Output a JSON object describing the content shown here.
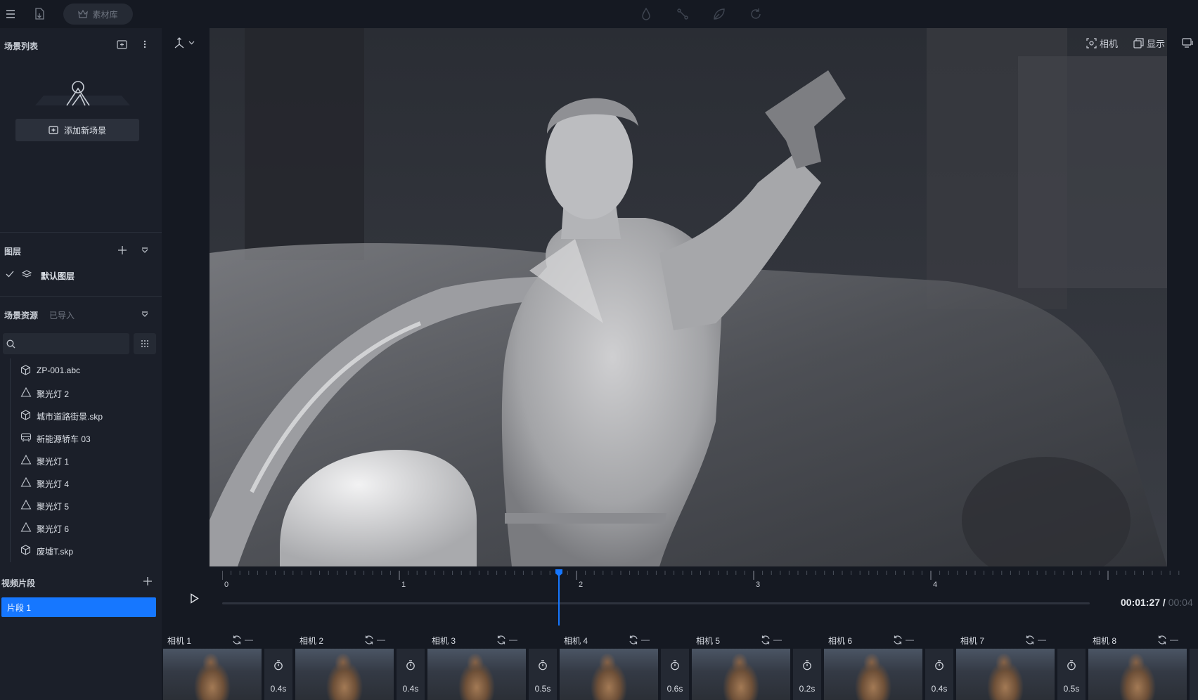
{
  "topbar": {
    "library_label": "素材库",
    "center_icons": [
      "drop-icon",
      "bone-icon",
      "leaf-icon",
      "refresh-icon"
    ]
  },
  "scene_list": {
    "title": "场景列表",
    "add_scene_label": "添加新场景"
  },
  "layers": {
    "title": "图层",
    "items": [
      {
        "label": "默认图层",
        "checked": true
      }
    ]
  },
  "assets": {
    "title": "场景资源",
    "tab_imported": "已导入",
    "search_placeholder": "",
    "items": [
      {
        "label": "ZP-001.abc",
        "icon": "cube-icon"
      },
      {
        "label": "聚光灯 2",
        "icon": "spotlight-icon"
      },
      {
        "label": "城市道路街景.skp",
        "icon": "cube-icon"
      },
      {
        "label": "新能源轿车 03",
        "icon": "car-icon"
      },
      {
        "label": "聚光灯 1",
        "icon": "spotlight-icon"
      },
      {
        "label": "聚光灯 4",
        "icon": "spotlight-icon"
      },
      {
        "label": "聚光灯 5",
        "icon": "spotlight-icon"
      },
      {
        "label": "聚光灯 6",
        "icon": "spotlight-icon"
      },
      {
        "label": "废墟T.skp",
        "icon": "cube-icon"
      }
    ]
  },
  "viewport": {
    "camera_label": "相机",
    "display_label": "显示"
  },
  "clips": {
    "title": "视频片段",
    "active_segment": "片段 1"
  },
  "timeline": {
    "ticks": [
      "0",
      "1",
      "2",
      "3",
      "4"
    ],
    "current_time": "00:01:27",
    "separator": " / ",
    "total_time": "00:04",
    "playhead_seconds": 1.9
  },
  "cameras": [
    {
      "name": "相机 1",
      "duration": "0.4s"
    },
    {
      "name": "相机 2",
      "duration": "0.4s"
    },
    {
      "name": "相机 3",
      "duration": "0.5s"
    },
    {
      "name": "相机 4",
      "duration": "0.6s"
    },
    {
      "name": "相机 5",
      "duration": "0.2s"
    },
    {
      "name": "相机 6",
      "duration": "0.4s"
    },
    {
      "name": "相机 7",
      "duration": "0.5s"
    },
    {
      "name": "相机 8",
      "duration": ""
    }
  ],
  "camera_ctrl_dash": "—",
  "colors": {
    "accent": "#1677ff",
    "panel": "#1b1f29",
    "background": "#151922"
  }
}
